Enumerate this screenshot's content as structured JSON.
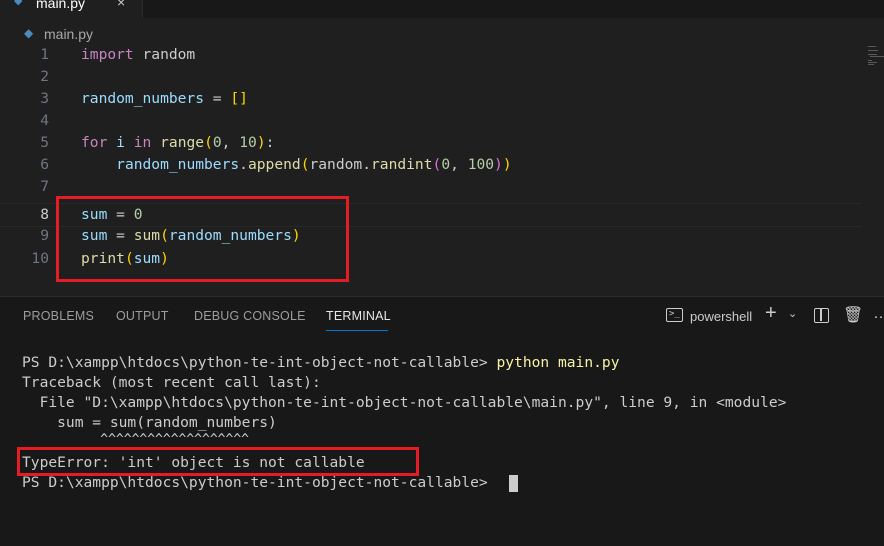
{
  "tab": {
    "icon": "python-icon",
    "label": "main.py",
    "close": "×"
  },
  "breadcrumb": {
    "icon": "python-icon",
    "label": "main.py"
  },
  "editor": {
    "line_numbers": [
      "1",
      "2",
      "3",
      "4",
      "5",
      "6",
      "7",
      "8",
      "9",
      "10"
    ],
    "lines": [
      "import random",
      "",
      "random_numbers = []",
      "",
      "for i in range(0, 10):",
      "    random_numbers.append(random.randint(0, 100))",
      "",
      "sum = 0",
      "sum = sum(random_numbers)",
      "print(sum)"
    ]
  },
  "panel": {
    "tabs": [
      "PROBLEMS",
      "OUTPUT",
      "DEBUG CONSOLE",
      "TERMINAL"
    ],
    "active_tab": "TERMINAL",
    "shell_label": "powershell",
    "add_symbol": "+",
    "chevron_symbol": "⌄",
    "trash_symbol": "🗑",
    "more_symbol": "…",
    "shell_icon_glyph": ">_"
  },
  "terminal": {
    "prompt1": "PS D:\\xampp\\htdocs\\python-te-int-object-not-callable> ",
    "command1": "python main.py",
    "traceback": "Traceback (most recent call last):",
    "file_line": "  File \"D:\\xampp\\htdocs\\python-te-int-object-not-callable\\main.py\", line 9, in <module>",
    "code_line": "    sum = sum(random_numbers)",
    "caret_line": "          ^^^^^^^^^^^^^^^^^^^",
    "error": "TypeError: 'int' object is not callable",
    "prompt2": "PS D:\\xampp\\htdocs\\python-te-int-object-not-callable> "
  },
  "colors": {
    "highlight_box": "#e51c23",
    "active_tab_underline": "#0078d4",
    "python_icon": "#4b8bbe"
  }
}
